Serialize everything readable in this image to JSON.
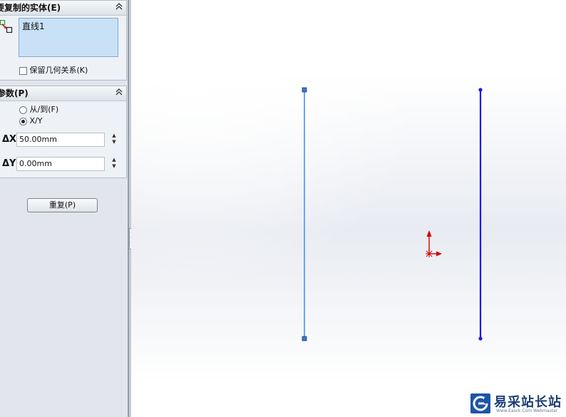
{
  "panel": {
    "entities_section": {
      "title": "要复制的实体(E)",
      "entities": [
        "直线1"
      ],
      "keep_relations_label": "保留几何关系(K)",
      "keep_relations_checked": false
    },
    "params_section": {
      "title": "参数(P)",
      "mode_from_to_label": "从/到(F)",
      "mode_xy_label": "X/Y",
      "selected_mode": "X/Y",
      "dx_label": "ΔX",
      "dx_value": "50.00mm",
      "dy_label": "ΔY",
      "dy_value": "0.00mm"
    },
    "repeat_button_label": "重复(P)"
  },
  "icons": {
    "collapse": "double-chevron-up-icon",
    "entity_select": "select-entities-icon",
    "spinner_up": "spinner-up-icon",
    "spinner_down": "spinner-down-icon",
    "origin": "sketch-origin-icon"
  },
  "canvas": {
    "colors": {
      "original_line": "#6aa6ec",
      "copied_line": "#1a1ae6",
      "origin": "#d40000",
      "endpoint_square": "#3a78c8"
    }
  },
  "watermark": {
    "text": "易采站长站",
    "sub": "Www.Easck.Com Webmaster"
  }
}
